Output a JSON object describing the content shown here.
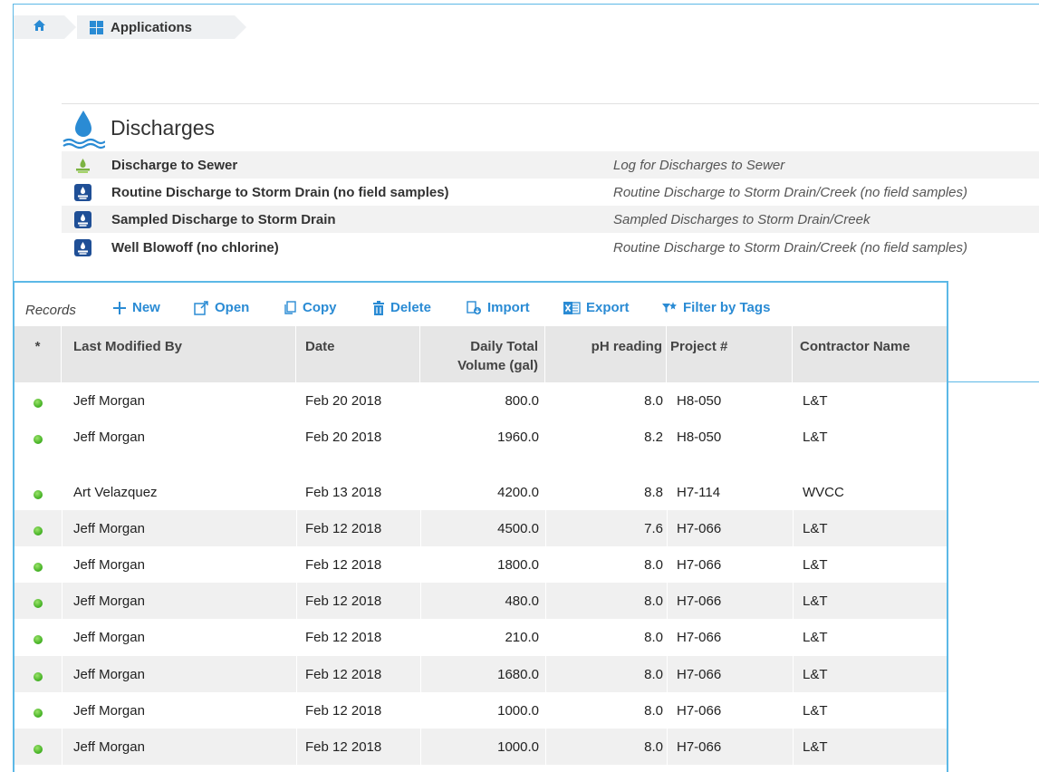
{
  "breadcrumb": {
    "home_icon": "home-icon",
    "apps_icon": "grid-icon",
    "apps_label": "Applications"
  },
  "group": {
    "title": "Discharges",
    "icon": "water-drop-icon",
    "apps": [
      {
        "name": "Discharge to Sewer",
        "desc": "Log for Discharges to Sewer",
        "icon": "sewer-icon"
      },
      {
        "name": "Routine Discharge to Storm Drain (no field samples)",
        "desc": "Routine Discharge to Storm Drain/Creek (no field samples)",
        "icon": "discharge-icon"
      },
      {
        "name": "Sampled Discharge to Storm Drain",
        "desc": "Sampled Discharges to Storm Drain/Creek",
        "icon": "discharge-icon"
      },
      {
        "name": "Well Blowoff (no chlorine)",
        "desc": "Routine Discharge to Storm Drain/Creek (no field samples)",
        "icon": "discharge-icon"
      }
    ]
  },
  "records": {
    "label": "Records",
    "toolbar": {
      "new": "New",
      "open": "Open",
      "copy": "Copy",
      "delete": "Delete",
      "import": "Import",
      "export": "Export",
      "filter": "Filter by Tags"
    },
    "columns": {
      "status": "*",
      "modified_by": "Last Modified By",
      "date": "Date",
      "volume_1": "Daily Total",
      "volume_2": "Volume (gal)",
      "ph": "pH reading",
      "project": "Project #",
      "contractor": "Contractor Name"
    },
    "rows": [
      {
        "modified_by": "Jeff Morgan",
        "date": "Feb 20 2018",
        "volume": "800.0",
        "ph": "8.0",
        "project": "H8-050",
        "contractor": "L&T"
      },
      {
        "modified_by": "Jeff Morgan",
        "date": "Feb 20 2018",
        "volume": "1960.0",
        "ph": "8.2",
        "project": "H8-050",
        "contractor": "L&T"
      },
      {
        "modified_by": "Art Velazquez",
        "date": "Feb 13 2018",
        "volume": "4200.0",
        "ph": "8.8",
        "project": "H7-114",
        "contractor": "WVCC"
      },
      {
        "modified_by": "Jeff Morgan",
        "date": "Feb 12 2018",
        "volume": "4500.0",
        "ph": "7.6",
        "project": "H7-066",
        "contractor": "L&T"
      },
      {
        "modified_by": "Jeff Morgan",
        "date": "Feb 12 2018",
        "volume": "1800.0",
        "ph": "8.0",
        "project": "H7-066",
        "contractor": "L&T"
      },
      {
        "modified_by": "Jeff Morgan",
        "date": "Feb 12 2018",
        "volume": "480.0",
        "ph": "8.0",
        "project": "H7-066",
        "contractor": "L&T"
      },
      {
        "modified_by": "Jeff Morgan",
        "date": "Feb 12 2018",
        "volume": "210.0",
        "ph": "8.0",
        "project": "H7-066",
        "contractor": "L&T"
      },
      {
        "modified_by": "Jeff Morgan",
        "date": "Feb 12 2018",
        "volume": "1680.0",
        "ph": "8.0",
        "project": "H7-066",
        "contractor": "L&T"
      },
      {
        "modified_by": "Jeff Morgan",
        "date": "Feb 12 2018",
        "volume": "1000.0",
        "ph": "8.0",
        "project": "H7-066",
        "contractor": "L&T"
      },
      {
        "modified_by": "Jeff Morgan",
        "date": "Feb 12 2018",
        "volume": "1000.0",
        "ph": "8.0",
        "project": "H7-066",
        "contractor": "L&T"
      }
    ]
  },
  "colors": {
    "accent": "#2a8bd4",
    "frame": "#5cb8e6",
    "status_ok": "#3fae20"
  }
}
